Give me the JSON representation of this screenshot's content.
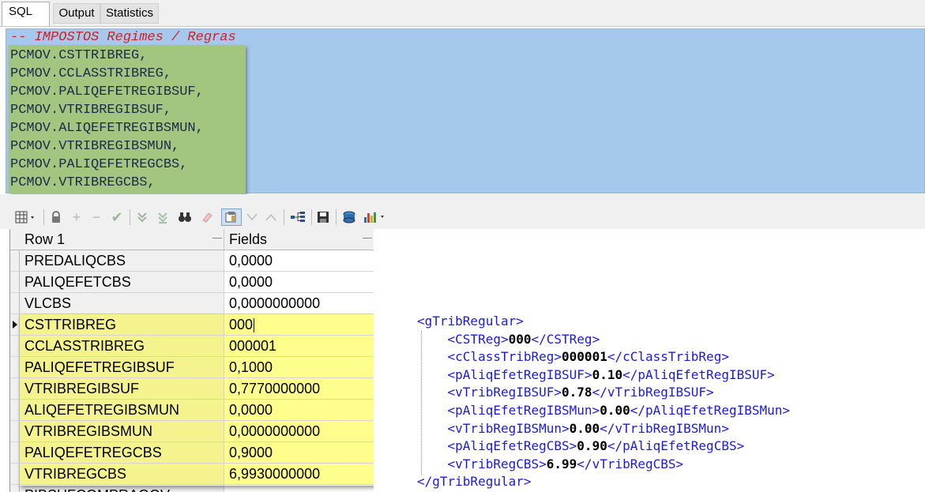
{
  "tabs": [
    {
      "label": "SQL",
      "active": true
    },
    {
      "label": "Output",
      "active": false
    },
    {
      "label": "Statistics",
      "active": false
    }
  ],
  "editor": {
    "comment": "-- IMPOSTOS Regimes / Regras",
    "lines": [
      "PCMOV.CSTTRIBREG,",
      "PCMOV.CCLASSTRIBREG,",
      "PCMOV.PALIQEFETREGIBSUF,",
      "PCMOV.VTRIBREGIBSUF,",
      "PCMOV.ALIQEFETREGIBSMUN,",
      "PCMOV.VTRIBREGIBSMUN,",
      "PCMOV.PALIQEFETREGCBS,",
      "PCMOV.VTRIBREGCBS,"
    ]
  },
  "toolbar": {
    "icons": [
      "grid-view-icon",
      "lock-icon",
      "add-icon",
      "remove-icon",
      "check-icon",
      "expand-down-icon",
      "collapse-down-icon",
      "binoculars-icon",
      "eraser-icon",
      "record-view-icon",
      "arrow-down-icon",
      "arrow-up-icon",
      "tree-icon",
      "save-icon",
      "database-icon",
      "chart-icon"
    ]
  },
  "grid": {
    "headers": [
      "Row 1",
      "Fields"
    ],
    "rows": [
      {
        "name": "PREDALIQCBS",
        "value": "0,0000",
        "highlight": false
      },
      {
        "name": "PALIQEFETCBS",
        "value": "0,0000",
        "highlight": false
      },
      {
        "name": "VLCBS",
        "value": "0,0000000000",
        "highlight": false
      },
      {
        "name": "CSTTRIBREG",
        "value": "000",
        "highlight": true,
        "current": true
      },
      {
        "name": "CCLASSTRIBREG",
        "value": "000001",
        "highlight": true
      },
      {
        "name": "PALIQEFETREGIBSUF",
        "value": "0,1000",
        "highlight": true
      },
      {
        "name": "VTRIBREGIBSUF",
        "value": "0,7770000000",
        "highlight": true
      },
      {
        "name": "ALIQEFETREGIBSMUN",
        "value": "0,0000",
        "highlight": true
      },
      {
        "name": "VTRIBREGIBSMUN",
        "value": "0,0000000000",
        "highlight": true
      },
      {
        "name": "PALIQEFETREGCBS",
        "value": "0,9000",
        "highlight": true
      },
      {
        "name": "VTRIBREGCBS",
        "value": "6,9930000000",
        "highlight": true
      },
      {
        "name": "PIBSUFCOMPRAGOV",
        "value": "",
        "highlight": false
      }
    ]
  },
  "xml": {
    "root_open": "<gTribRegular>",
    "root_close": "</gTribRegular>",
    "items": [
      {
        "open": "<CSTReg>",
        "value": "000",
        "close": "</CSTReg>"
      },
      {
        "open": "<cClassTribReg>",
        "value": "000001",
        "close": "</cClassTribReg>"
      },
      {
        "open": "<pAliqEfetRegIBSUF>",
        "value": "0.10",
        "close": "</pAliqEfetRegIBSUF>"
      },
      {
        "open": "<vTribRegIBSUF>",
        "value": "0.78",
        "close": "</vTribRegIBSUF>"
      },
      {
        "open": "<pAliqEfetRegIBSMun>",
        "value": "0.00",
        "close": "</pAliqEfetRegIBSMun>"
      },
      {
        "open": "<vTribRegIBSMun>",
        "value": "0.00",
        "close": "</vTribRegIBSMun>"
      },
      {
        "open": "<pAliqEfetRegCBS>",
        "value": "0.90",
        "close": "</pAliqEfetRegCBS>"
      },
      {
        "open": "<vTribRegCBS>",
        "value": "6.99",
        "close": "</vTribRegCBS>"
      }
    ]
  },
  "colors": {
    "editor_bg": "#a6c8ed",
    "editor_highlight": "#a2c57f",
    "grid_highlight": "#fefe8c",
    "xml_tag": "#1a1ae6"
  }
}
